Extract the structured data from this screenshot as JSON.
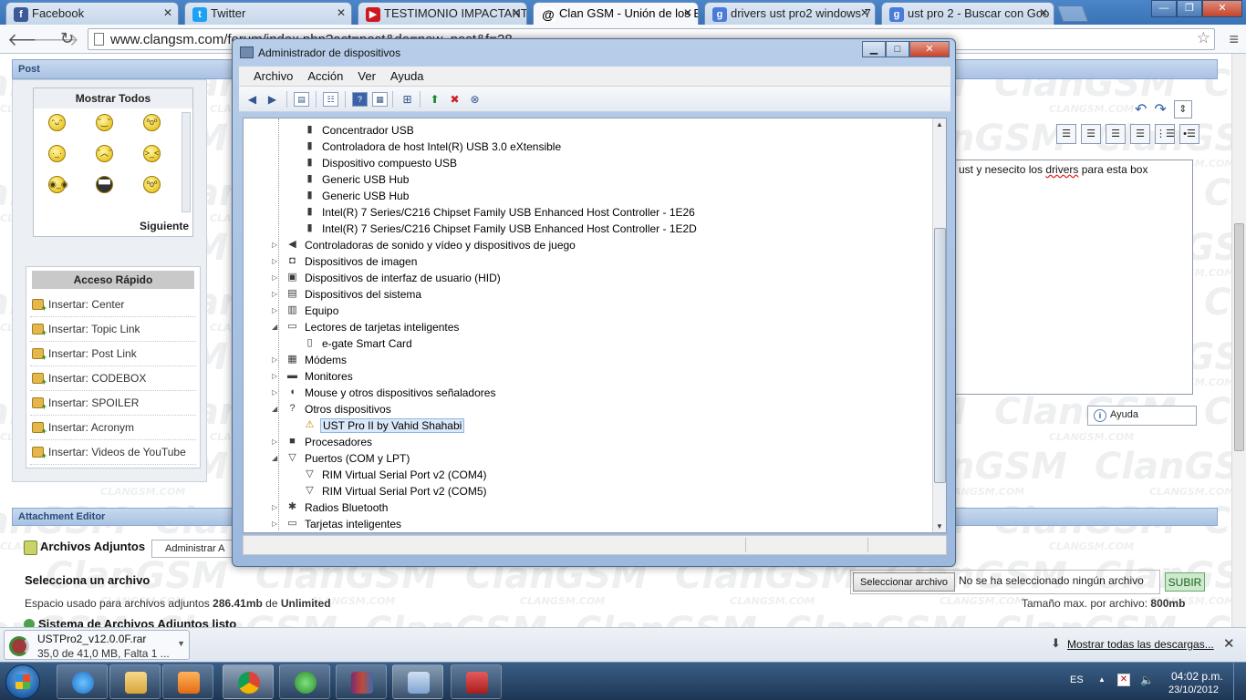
{
  "browser": {
    "tabs": [
      {
        "label": "Facebook",
        "icon": "facebook-icon",
        "color": "#3b5998",
        "glyph": "f"
      },
      {
        "label": "Twitter",
        "icon": "twitter-icon",
        "color": "#1da1f2",
        "glyph": "t"
      },
      {
        "label": "TESTIMONIO IMPACTANT",
        "icon": "youtube-icon",
        "color": "#cc181e",
        "glyph": "▶"
      },
      {
        "label": "Clan GSM - Unión de los Ex",
        "icon": "clangsm-icon",
        "color": "#ffffff",
        "glyph": "@"
      },
      {
        "label": "drivers ust pro2 windows 7",
        "icon": "google-icon",
        "color": "#4a7bd8",
        "glyph": "g"
      },
      {
        "label": "ust pro 2 - Buscar con Goo",
        "icon": "google-icon",
        "color": "#4a7bd8",
        "glyph": "g"
      }
    ],
    "url": "www.clangsm.com/forum/index.php?act=post&do=new_post&f=28"
  },
  "page": {
    "watermark": "ClanGSM",
    "watermark_small": "CLANGSM.COM",
    "post_section": "Post",
    "smilies_header": "Mostrar Todos",
    "smilies_next": "Siguiente",
    "quick_access_header": "Acceso Rápido",
    "quick_items": [
      "Insertar: Center",
      "Insertar: Topic Link",
      "Insertar: Post Link",
      "Insertar: CODEBOX",
      "Insertar: SPOILER",
      "Insertar: Acronym",
      "Insertar: Videos de YouTube"
    ],
    "editor_text_pre": "ust y nesecito los ",
    "editor_text_spell": "drivers",
    "editor_text_post": " para esta box",
    "help_button": "Ayuda",
    "attachment_section": "Attachment Editor",
    "attachments_label": "Archivos Adjuntos",
    "admin_button": "Administrar A",
    "select_file_label": "Selecciona un archivo",
    "space_prefix": "Espacio usado para archivos adjuntos ",
    "space_used": "286.41mb",
    "space_mid": " de ",
    "space_limit": "Unlimited",
    "system_label": "Sistema de Archivos Adjuntos listo",
    "file_button": "Seleccionar archivo",
    "no_file": "No se ha seleccionado ningún archivo",
    "upload_button": "SUBIR",
    "max_size_prefix": "Tamaño max. por archivo: ",
    "max_size": "800mb"
  },
  "device_manager": {
    "title": "Administrador de dispositivos",
    "menu": [
      "Archivo",
      "Acción",
      "Ver",
      "Ayuda"
    ],
    "tree": [
      {
        "label": "Concentrador USB",
        "level": 1,
        "icon": "usb-plug-icon",
        "glyph": "▮"
      },
      {
        "label": "Controladora de host Intel(R) USB 3.0 eXtensible",
        "level": 1,
        "icon": "usb-plug-icon",
        "glyph": "▮"
      },
      {
        "label": "Dispositivo compuesto USB",
        "level": 1,
        "icon": "usb-plug-icon",
        "glyph": "▮"
      },
      {
        "label": "Generic USB Hub",
        "level": 1,
        "icon": "usb-plug-icon",
        "glyph": "▮"
      },
      {
        "label": "Generic USB Hub",
        "level": 1,
        "icon": "usb-plug-icon",
        "glyph": "▮"
      },
      {
        "label": "Intel(R) 7 Series/C216 Chipset Family USB Enhanced Host Controller - 1E26",
        "level": 1,
        "icon": "usb-plug-icon",
        "glyph": "▮"
      },
      {
        "label": "Intel(R) 7 Series/C216 Chipset Family USB Enhanced Host Controller - 1E2D",
        "level": 1,
        "icon": "usb-plug-icon",
        "glyph": "▮"
      },
      {
        "label": "Controladoras de sonido y vídeo y dispositivos de juego",
        "level": 0,
        "expand": "▷",
        "icon": "speaker-icon",
        "glyph": "◀"
      },
      {
        "label": "Dispositivos de imagen",
        "level": 0,
        "expand": "▷",
        "icon": "camera-icon",
        "glyph": "◘"
      },
      {
        "label": "Dispositivos de interfaz de usuario (HID)",
        "level": 0,
        "expand": "▷",
        "icon": "hid-icon",
        "glyph": "▣"
      },
      {
        "label": "Dispositivos del sistema",
        "level": 0,
        "expand": "▷",
        "icon": "system-device-icon",
        "glyph": "▤"
      },
      {
        "label": "Equipo",
        "level": 0,
        "expand": "▷",
        "icon": "computer-icon",
        "glyph": "▥"
      },
      {
        "label": "Lectores de tarjetas inteligentes",
        "level": 0,
        "expand": "◢",
        "icon": "smart-card-reader-icon",
        "glyph": "▭"
      },
      {
        "label": "e-gate Smart Card",
        "level": 1,
        "icon": "smart-card-icon",
        "glyph": "▯"
      },
      {
        "label": "Módems",
        "level": 0,
        "expand": "▷",
        "icon": "modem-icon",
        "glyph": "▦"
      },
      {
        "label": "Monitores",
        "level": 0,
        "expand": "▷",
        "icon": "monitor-icon",
        "glyph": "▬"
      },
      {
        "label": "Mouse y otros dispositivos señaladores",
        "level": 0,
        "expand": "▷",
        "icon": "mouse-icon",
        "glyph": "◖"
      },
      {
        "label": "Otros dispositivos",
        "level": 0,
        "expand": "◢",
        "icon": "unknown-device-icon",
        "glyph": "?"
      },
      {
        "label": "UST Pro II by Vahid Shahabi",
        "level": 1,
        "selected": true,
        "icon": "warning-device-icon",
        "glyph": "⚠"
      },
      {
        "label": "Procesadores",
        "level": 0,
        "expand": "▷",
        "icon": "processor-icon",
        "glyph": "■"
      },
      {
        "label": "Puertos (COM y LPT)",
        "level": 0,
        "expand": "◢",
        "icon": "port-icon",
        "glyph": "▽"
      },
      {
        "label": "RIM Virtual Serial Port v2 (COM4)",
        "level": 1,
        "icon": "port-icon",
        "glyph": "▽"
      },
      {
        "label": "RIM Virtual Serial Port v2 (COM5)",
        "level": 1,
        "icon": "port-icon",
        "glyph": "▽"
      },
      {
        "label": "Radios Bluetooth",
        "level": 0,
        "expand": "▷",
        "icon": "bluetooth-icon",
        "glyph": "✱"
      },
      {
        "label": "Tarjetas inteligentes",
        "level": 0,
        "expand": "▷",
        "icon": "smart-card-icon",
        "glyph": "▭"
      }
    ]
  },
  "downloads": {
    "file_name": "USTPro2_v12.0.0F.rar",
    "progress_text": "35,0 de 41,0 MB, Falta 1 ...",
    "show_all": "Mostrar todas las descargas..."
  },
  "taskbar": {
    "language": "ES",
    "time": "04:02 p.m.",
    "date": "23/10/2012"
  }
}
